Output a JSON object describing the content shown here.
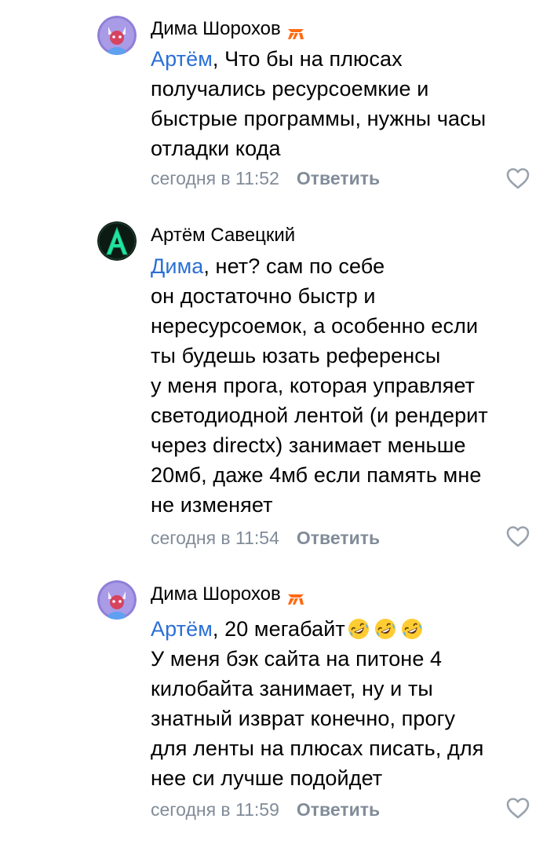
{
  "colors": {
    "mention": "#2a6fd6",
    "meta": "#818c99",
    "badge": "#ff6a13",
    "text": "#000000"
  },
  "comments": [
    {
      "author": "Дима Шорохов",
      "badge_icon": "fnatic-badge-icon",
      "mention": "Артём",
      "lines": [
        ", Что бы на плюсах",
        "получались ресурсоемкие и",
        "быстрые программы, нужны часы",
        "отладки кода"
      ],
      "time": "сегодня в 11:52",
      "reply_label": "Ответить"
    },
    {
      "author": "Артём Савецкий",
      "mention": "Дима",
      "lines": [
        ", нет? сам по себе",
        "он достаточно быстр и",
        "нересурсоемок, а особенно если",
        "ты будешь юзать референсы",
        "у меня прога, которая управляет",
        "светодиодной лентой (и рендерит",
        "через directx) занимает меньше",
        "20мб, даже 4мб если память мне",
        "не изменяет"
      ],
      "time": "сегодня в 11:54",
      "reply_label": "Ответить"
    },
    {
      "author": "Дима Шорохов",
      "badge_icon": "fnatic-badge-icon",
      "mention": "Артём",
      "lines": [
        ", 20 мегабайт",
        "У меня бэк сайта на питоне 4",
        "килобайта занимает, ну и ты",
        "знатный изврат конечно, прогу",
        "для ленты на плюсах писать, для",
        "нее си лучше подойдет"
      ],
      "emoji": [
        "rofl-emoji",
        "rofl-emoji",
        "rofl-emoji"
      ],
      "time": "сегодня в 11:59",
      "reply_label": "Ответить"
    }
  ]
}
